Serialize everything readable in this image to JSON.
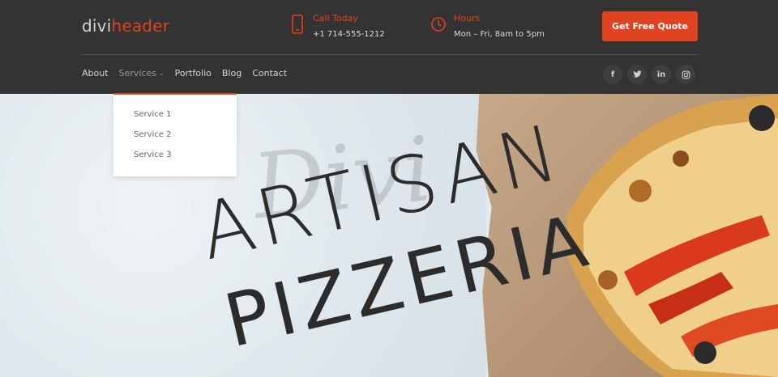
{
  "logo": {
    "part1": "divi",
    "part2": "header"
  },
  "contact": {
    "call_label": "Call Today",
    "call_value": "+1 714-555-1212",
    "hours_label": "Hours",
    "hours_value": "Mon – Fri, 8am to 5pm"
  },
  "cta": {
    "label": "Get Free Quote"
  },
  "nav": {
    "items": [
      {
        "label": "About"
      },
      {
        "label": "Services"
      },
      {
        "label": "Portfolio"
      },
      {
        "label": "Blog"
      },
      {
        "label": "Contact"
      }
    ]
  },
  "dropdown": {
    "items": [
      {
        "label": "Service 1"
      },
      {
        "label": "Service 2"
      },
      {
        "label": "Service 3"
      }
    ]
  },
  "social": [
    {
      "icon": "facebook-icon",
      "glyph": "f"
    },
    {
      "icon": "twitter-icon",
      "glyph": "t"
    },
    {
      "icon": "linkedin-icon",
      "glyph": "in"
    },
    {
      "icon": "instagram-icon",
      "glyph": "◎"
    }
  ],
  "hero": {
    "script": "Divi",
    "line1": "ARTISAN",
    "line2": "PIZZERIA"
  },
  "colors": {
    "accent": "#e0431f",
    "header_bg": "#333333"
  }
}
